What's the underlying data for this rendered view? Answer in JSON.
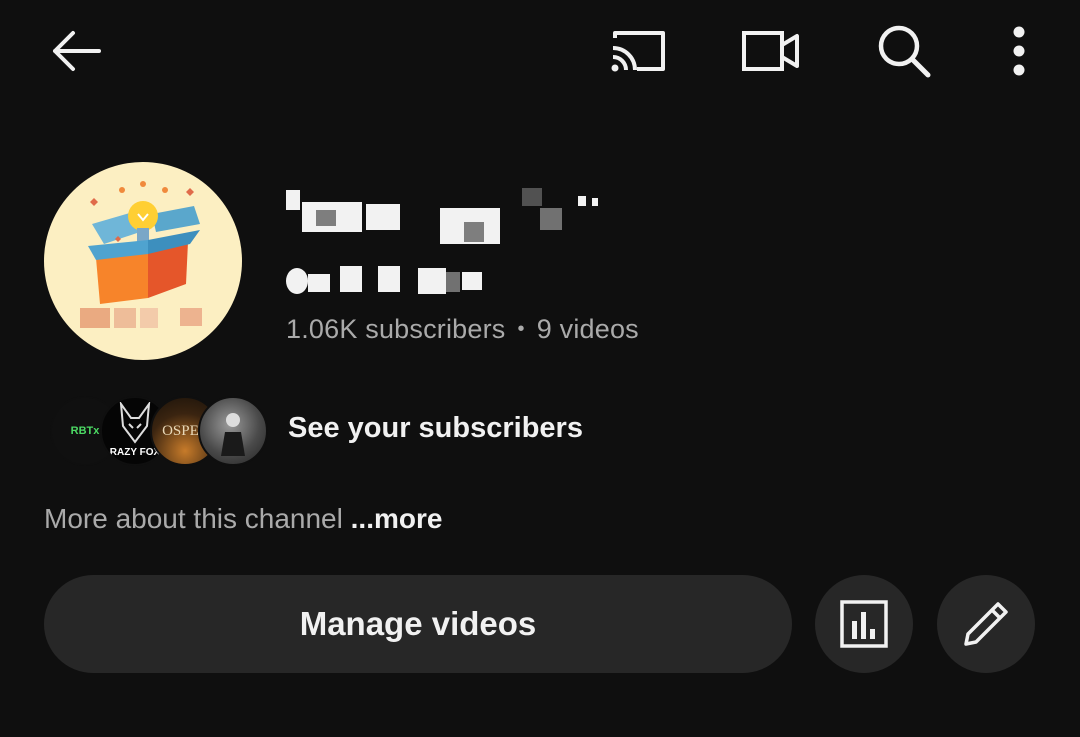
{
  "topbar": {
    "back_icon": "arrow-left-icon",
    "cast_icon": "cast-icon",
    "create_icon": "video-camera-icon",
    "search_icon": "search-icon",
    "menu_icon": "more-vertical-icon"
  },
  "channel": {
    "name": "",
    "handle": "",
    "subscribers": "1.06K subscribers",
    "separator": "•",
    "videos": "9 videos"
  },
  "subscribers_row": {
    "label": "See your subscribers",
    "avatars": [
      {
        "text": "RBTx"
      },
      {
        "text": "RAZY FOX"
      },
      {
        "text": "OSPEL"
      },
      {
        "text": ""
      }
    ]
  },
  "about": {
    "text": "More about this channel",
    "more_label": "...more"
  },
  "actions": {
    "manage_label": "Manage videos",
    "analytics_icon": "analytics-chart-icon",
    "edit_icon": "pencil-icon"
  },
  "colors": {
    "background": "#0f0f0f",
    "button_bg": "#272727",
    "secondary_text": "#aaaaaa",
    "primary_text": "#f1f1f1",
    "avatar_bg": "#fcefc2"
  }
}
